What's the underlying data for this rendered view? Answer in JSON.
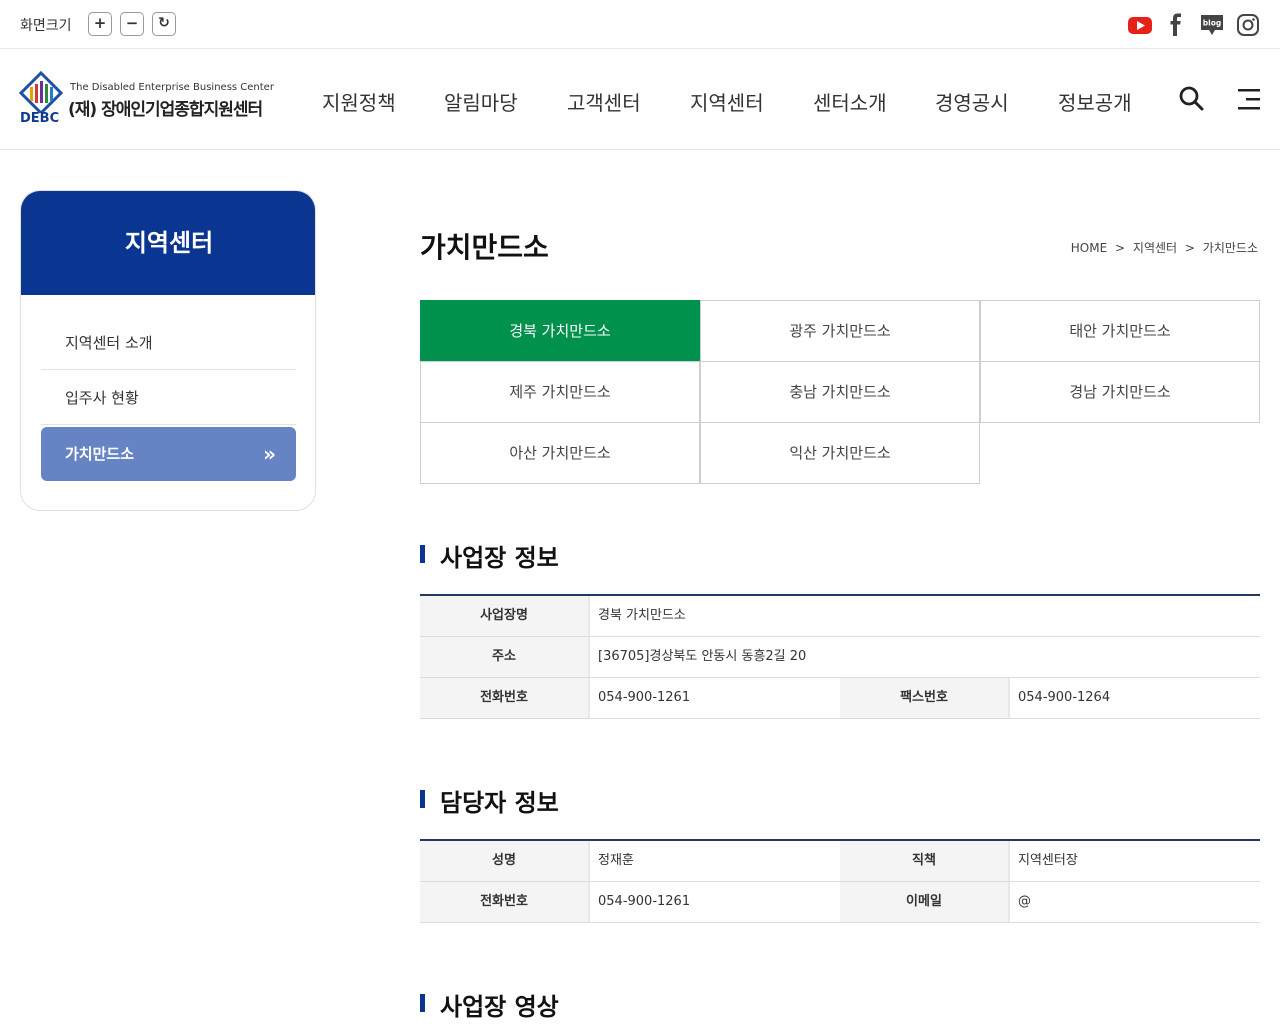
{
  "topbar": {
    "zoom_label": "화면크기",
    "zoom_in": "+",
    "zoom_out": "−",
    "zoom_reset": "↻",
    "social": [
      "youtube-icon",
      "facebook-icon",
      "blog-icon",
      "instagram-icon"
    ],
    "blog_text": "blog"
  },
  "header": {
    "logo_en": "The Disabled Enterprise Business Center",
    "logo_ko": "(재) 장애인기업종합지원센터",
    "logo_abbr": "DEBC",
    "nav": [
      "지원정책",
      "알림마당",
      "고객센터",
      "지역센터",
      "센터소개",
      "경영공시",
      "정보공개"
    ]
  },
  "sidebar": {
    "title": "지역센터",
    "items": [
      {
        "label": "지역센터 소개"
      },
      {
        "label": "입주사 현황"
      },
      {
        "label": "가치만드소",
        "chevron": "»"
      }
    ]
  },
  "main": {
    "title": "가치만드소",
    "breadcrumb": [
      "HOME",
      ">",
      "지역센터",
      ">",
      "가치만드소"
    ],
    "tabs": [
      "경북 가치만드소",
      "광주 가치만드소",
      "태안 가치만드소",
      "제주 가치만드소",
      "충남 가치만드소",
      "경남 가치만드소",
      "아산 가치만드소",
      "익산 가치만드소"
    ]
  },
  "business_info": {
    "title": "사업장 정보",
    "name_label": "사업장명",
    "name_value": "경북 가치만드소",
    "addr_label": "주소",
    "addr_value": "[36705]경상북도 안동시 동흥2길 20",
    "tel_label": "전화번호",
    "tel_value": "054-900-1261",
    "fax_label": "팩스번호",
    "fax_value": "054-900-1264"
  },
  "manager_info": {
    "title": "담당자 정보",
    "name_label": "성명",
    "name_value": "정재훈",
    "position_label": "직책",
    "position_value": "지역센터장",
    "tel_label": "전화번호",
    "tel_value": "054-900-1261",
    "email_label": "이메일",
    "email_value": "@"
  },
  "video_section": {
    "title": "사업장 영상"
  },
  "colors": {
    "primary": "#0a3590",
    "active_tab": "#00914d",
    "side_active": "#6683c4"
  }
}
